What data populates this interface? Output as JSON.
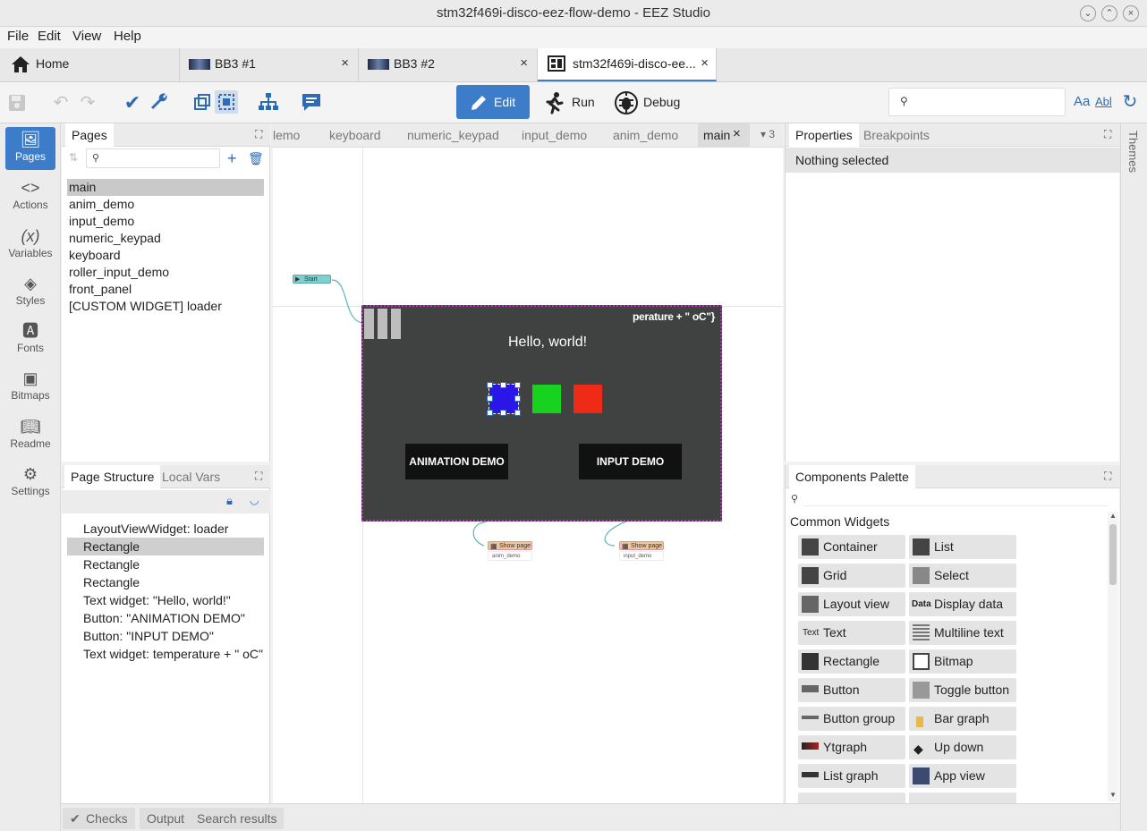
{
  "window": {
    "title": "stm32f469i-disco-eez-flow-demo - EEZ Studio"
  },
  "menu": [
    "File",
    "Edit",
    "View",
    "Help"
  ],
  "tabs": [
    {
      "label": "Home",
      "icon": "home-icon"
    },
    {
      "label": "BB3 #1",
      "icon": "instrument-thumbnail-icon",
      "close": "×"
    },
    {
      "label": "BB3 #2",
      "icon": "instrument-thumbnail-icon",
      "close": "×"
    },
    {
      "label": "stm32f469i-disco-ee...",
      "icon": "project-icon",
      "close": "×"
    }
  ],
  "toolbar": {
    "edit": "Edit",
    "run": "Run",
    "debug": "Debug",
    "search_placeholder": "",
    "match_case": "Aa",
    "whole_word": "Abl"
  },
  "leftnav": [
    "Pages",
    "Actions",
    "Variables",
    "Styles",
    "Fonts",
    "Bitmaps",
    "Readme",
    "Settings"
  ],
  "pages_panel": {
    "title": "Pages",
    "search_placeholder": "",
    "items": [
      "main",
      "anim_demo",
      "input_demo",
      "numeric_keypad",
      "keyboard",
      "roller_input_demo",
      "front_panel",
      "[CUSTOM WIDGET] loader"
    ],
    "selected": "main"
  },
  "structure_panel": {
    "tabs": [
      "Page Structure",
      "Local Vars"
    ],
    "items": [
      "LayoutViewWidget: loader",
      "Rectangle",
      "Rectangle",
      "Rectangle",
      "Text widget: \"Hello, world!\"",
      "Button: \"ANIMATION DEMO\"",
      "Button: \"INPUT DEMO\"",
      "Text widget: temperature + \" oC\""
    ],
    "selected_index": 1
  },
  "editor_tabs": [
    "lemo",
    "keyboard",
    "numeric_keypad",
    "input_demo",
    "anim_demo",
    "main"
  ],
  "editor_tabs_overflow": "3",
  "canvas": {
    "start_node": "Start",
    "hello_text": "Hello, world!",
    "temp_text": "perature + \" oC\"}",
    "anim_button": "ANIMATION DEMO",
    "input_button": "INPUT DEMO",
    "show_page_label": "Show page",
    "show_page_1_target": "anim_demo",
    "show_page_2_target": "input_demo",
    "colors": {
      "screen": "#404241",
      "blue": "#2b16e8",
      "green": "#17d21f",
      "red": "#ef2a17"
    }
  },
  "properties_panel": {
    "tabs": [
      "Properties",
      "Breakpoints"
    ],
    "status": "Nothing selected"
  },
  "palette": {
    "title": "Components Palette",
    "section": "Common Widgets",
    "items": [
      [
        "Container",
        "List"
      ],
      [
        "Grid",
        "Select"
      ],
      [
        "Layout view",
        "Display data"
      ],
      [
        "Text",
        "Multiline text"
      ],
      [
        "Rectangle",
        "Bitmap"
      ],
      [
        "Button",
        "Toggle button"
      ],
      [
        "Button group",
        "Bar graph"
      ],
      [
        "Ytgraph",
        "Up down"
      ],
      [
        "List graph",
        "App view"
      ]
    ],
    "text_icon": "Text",
    "data_icon": "Data"
  },
  "bottom_tabs": [
    "Checks",
    "Output",
    "Search results"
  ],
  "themes": "Themes"
}
